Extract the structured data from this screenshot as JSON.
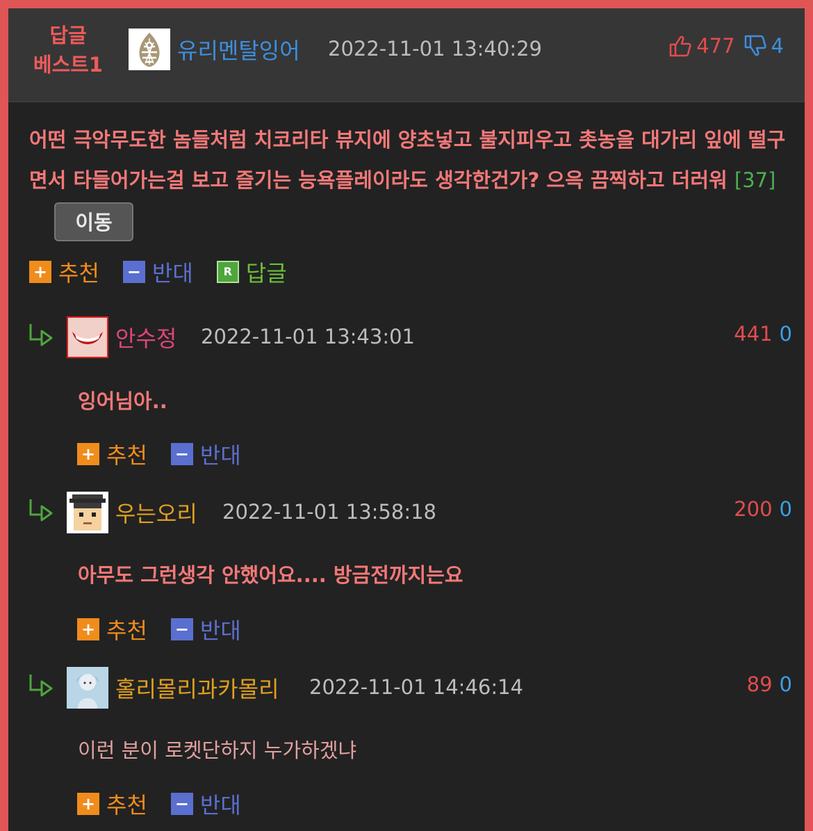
{
  "best_comment": {
    "badge_line1": "답글",
    "badge_line2": "베스트1",
    "author": "유리멘탈잉어",
    "datetime": "2022-11-01 13:40:29",
    "upvotes": "477",
    "downvotes": "4",
    "text": "어떤 극악무도한 놈들처럼 치코리타 뷰지에 양초넣고 불지피우고 촛농을 대가리 잎에 떨구면서 타들어가는걸 보고 즐기는 능욕플레이라도 생각한건가? 으윽 끔찍하고 더러워",
    "reply_count": "[37]",
    "move_label": "이동",
    "actions": {
      "recommend": "추천",
      "oppose": "반대",
      "reply": "답글"
    }
  },
  "replies": [
    {
      "author": "안수정",
      "author_color": "#e0457a",
      "datetime": "2022-11-01 13:43:01",
      "up": "441",
      "down": "0",
      "text": "잉어님아..",
      "bold": true,
      "recommend": "추천",
      "oppose": "반대"
    },
    {
      "author": "우는오리",
      "author_color": "#e0a020",
      "datetime": "2022-11-01 13:58:18",
      "up": "200",
      "down": "0",
      "text": "아무도 그런생각 안했어요.... 방금전까지는요",
      "bold": true,
      "recommend": "추천",
      "oppose": "반대"
    },
    {
      "author": "홀리몰리과카몰리",
      "author_color": "#e0a020",
      "datetime": "2022-11-01 14:46:14",
      "up": "89",
      "down": "0",
      "text": "이런 분이 로켓단하지 누가하겠냐",
      "bold": false,
      "recommend": "추천",
      "oppose": "반대"
    }
  ],
  "icons": {
    "thumbs_up": "thumbs-up-icon",
    "thumbs_down": "thumbs-down-icon",
    "reply_arrow": "reply-arrow-icon"
  },
  "colors": {
    "border": "#e05555",
    "background": "#222222",
    "header_background": "#363636",
    "comment_text": "#f47878",
    "recommend": "#f08c1c",
    "oppose": "#5a6fcf",
    "reply": "#4fa53c"
  }
}
